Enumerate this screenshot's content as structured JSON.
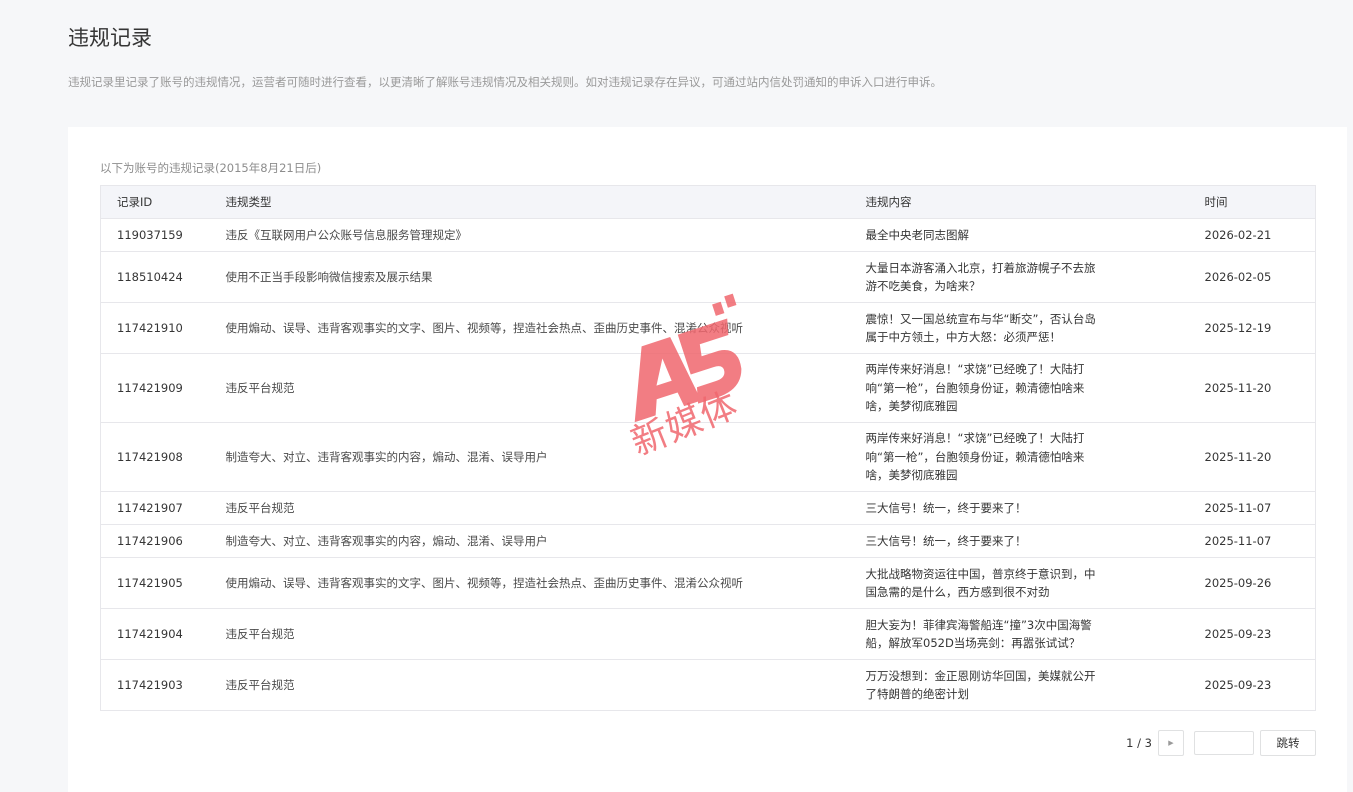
{
  "page": {
    "title": "违规记录",
    "description": "违规记录里记录了账号的违规情况，运营者可随时进行查看，以更清晰了解账号违规情况及相关规则。如对违规记录存在异议，可通过站内信处罚通知的申诉入口进行申诉。"
  },
  "card": {
    "note": "以下为账号的违规记录(2015年8月21日后)"
  },
  "table": {
    "columns": [
      "记录ID",
      "违规类型",
      "违规内容",
      "时间"
    ],
    "rows": [
      {
        "id": "119037159",
        "type": "违反《互联网用户公众账号信息服务管理规定》",
        "content": "最全中央老同志图解",
        "time": "2026-02-21"
      },
      {
        "id": "118510424",
        "type": "使用不正当手段影响微信搜索及展示结果",
        "content": "大量日本游客涌入北京，打着旅游幌子不去旅游不吃美食，为啥来？",
        "time": "2026-02-05"
      },
      {
        "id": "117421910",
        "type": "使用煽动、误导、违背客观事实的文字、图片、视频等，捏造社会热点、歪曲历史事件、混淆公众视听",
        "content": "震惊！又一国总统宣布与华“断交”，否认台岛属于中方领土，中方大怒：必须严惩！",
        "time": "2025-12-19"
      },
      {
        "id": "117421909",
        "type": "违反平台规范",
        "content": "两岸传来好消息！“求饶”已经晚了！大陆打响“第一枪”，台胞领身份证，赖清德怕啥来啥，美梦彻底雅园",
        "time": "2025-11-20"
      },
      {
        "id": "117421908",
        "type": "制造夸大、对立、违背客观事实的内容，煽动、混淆、误导用户",
        "content": "两岸传来好消息！“求饶”已经晚了！大陆打响“第一枪”，台胞领身份证，赖清德怕啥来啥，美梦彻底雅园",
        "time": "2025-11-20"
      },
      {
        "id": "117421907",
        "type": "违反平台规范",
        "content": "三大信号！统一，终于要来了！",
        "time": "2025-11-07"
      },
      {
        "id": "117421906",
        "type": "制造夸大、对立、违背客观事实的内容，煽动、混淆、误导用户",
        "content": "三大信号！统一，终于要来了！",
        "time": "2025-11-07"
      },
      {
        "id": "117421905",
        "type": "使用煽动、误导、违背客观事实的文字、图片、视频等，捏造社会热点、歪曲历史事件、混淆公众视听",
        "content": "大批战略物资运往中国，普京终于意识到，中国急需的是什么，西方感到很不对劲",
        "time": "2025-09-26"
      },
      {
        "id": "117421904",
        "type": "违反平台规范",
        "content": "胆大妄为！菲律宾海警船连“撞”3次中国海警船，解放军052D当场亮剑：再嚣张试试？",
        "time": "2025-09-23"
      },
      {
        "id": "117421903",
        "type": "违反平台规范",
        "content": "万万没想到：金正恩刚访华回国，美媒就公开了特朗普的绝密计划",
        "time": "2025-09-23"
      }
    ]
  },
  "pagination": {
    "label": "1 / 3",
    "jump_label": "跳转",
    "input_value": ""
  },
  "watermark": {
    "logo_text": "A5",
    "caption": "新媒体",
    "color": "#f0676e"
  },
  "colors": {
    "background": "#f6f7f9",
    "header_bg": "#f4f5f9",
    "border": "#e7e7eb"
  }
}
